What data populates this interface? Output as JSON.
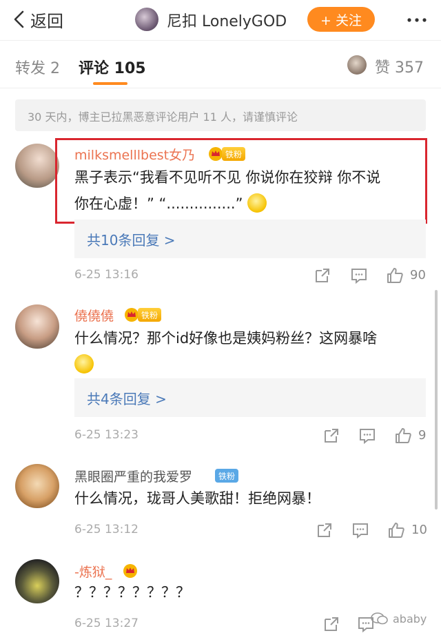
{
  "header": {
    "back_label": "返回",
    "user_name": "尼扣 LonelyGOD",
    "follow_label": "+ 关注"
  },
  "tabs": {
    "repost": "转发 2",
    "comments": "评论 105",
    "likes": "赞 357"
  },
  "notice": "30 天内，博主已拉黑恶意评论用户 11 人，请谨慎评论",
  "comments": [
    {
      "user": "milksmelllbest女乃",
      "badge": "铁粉",
      "line1": "黑子表示“我看不见听不见 你说你在狡辩 你不说",
      "line2": "你在心虚！” “...............”",
      "replies": "共10条回复 >",
      "time": "6-25 13:16",
      "likes": "90"
    },
    {
      "user": "僥僥僥",
      "badge": "铁粉",
      "line1": "什么情况？那个id好像也是姨妈粉丝？这网暴啥",
      "replies": "共4条回复 >",
      "time": "6-25 13:23",
      "likes": "9"
    },
    {
      "user": "黑眼圈严重的我爱罗",
      "badge": "铁粉",
      "line1": "什么情况，珑哥人美歌甜！拒绝网暴！",
      "time": "6-25 13:12",
      "likes": "10"
    },
    {
      "user": "-炼狱_",
      "line1": "？？？？？？？？",
      "time": "6-25 13:27"
    }
  ],
  "watermark": "ababy",
  "colors": {
    "accent": "#ff8a1f",
    "username": "#eb7350",
    "link": "#4a79b8",
    "highlight_border": "#d9262f"
  }
}
